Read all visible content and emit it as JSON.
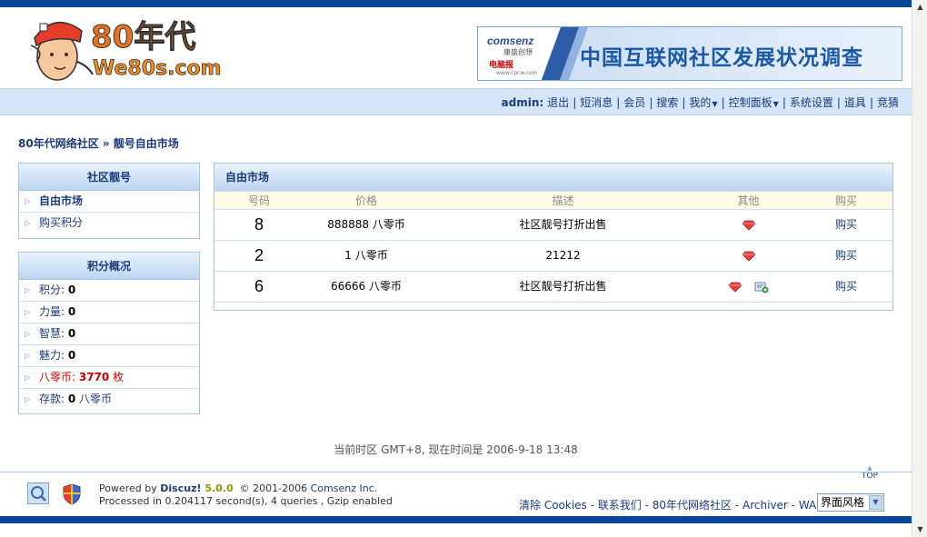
{
  "header": {
    "logo_text": "80年代",
    "logo_domain": "We80s.com",
    "banner": {
      "brand": "comsenz",
      "brand_sub": "康盛创想",
      "partner": "电脑报",
      "partner_url": "www.cpcw.com",
      "title": "中国互联网社区发展状况调查"
    }
  },
  "nav": {
    "user": "admin:",
    "items": [
      "退出",
      "短消息",
      "会员",
      "搜索",
      "我的",
      "控制面板",
      "系统设置",
      "道具",
      "竞猜"
    ]
  },
  "breadcrumb": "80年代网络社区 » 靓号自由市场",
  "sidebar": {
    "box1": {
      "title": "社区靓号",
      "items": [
        "自由市场",
        "购买积分"
      ]
    },
    "box2": {
      "title": "积分概况",
      "items": [
        {
          "label": "积分: ",
          "value": "0",
          "suffix": ""
        },
        {
          "label": "力量: ",
          "value": "0",
          "suffix": ""
        },
        {
          "label": "智慧: ",
          "value": "0",
          "suffix": ""
        },
        {
          "label": "魅力: ",
          "value": "0",
          "suffix": ""
        },
        {
          "label": "八零币: ",
          "value": "3770",
          "suffix": " 枚"
        },
        {
          "label": "存款: ",
          "value": "0",
          "suffix": " 八零币"
        }
      ]
    }
  },
  "market": {
    "title": "自由市场",
    "columns": [
      "号码",
      "价格",
      "描述",
      "其他",
      "购买"
    ],
    "rows": [
      {
        "number": "8",
        "price": "888888 八零币",
        "desc": "社区靓号打折出售",
        "buy": "购买"
      },
      {
        "number": "2",
        "price": "1 八零币",
        "desc": "21212",
        "buy": "购买"
      },
      {
        "number": "6",
        "price": "66666 八零币",
        "desc": "社区靓号打折出售",
        "buy": "购买"
      }
    ]
  },
  "footer": {
    "time": "当前时区 GMT+8, 现在时间是 2006-9-18 13:48",
    "top": "TOP",
    "powered_by": "Powered by ",
    "discuz": "Discuz!",
    "version": " 5.0.0",
    "copyright": "© 2001-2006 ",
    "comsenz": "Comsenz Inc.",
    "processed": "Processed in 0.204117 second(s), 4 queries , Gzip enabled",
    "links": [
      "清除 Cookies",
      "联系我们",
      "80年代网络社区",
      "Archiver",
      "WAP"
    ],
    "style_select": "界面风格"
  },
  "colors": {
    "brand_blue": "#0a4699",
    "link_blue": "#1a3c7d",
    "coin_red": "#cc0000"
  }
}
